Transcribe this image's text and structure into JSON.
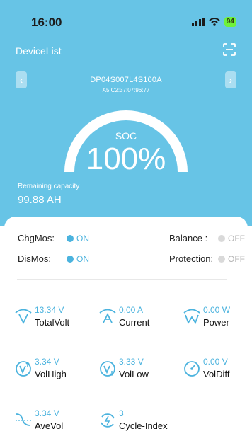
{
  "status": {
    "time": "16:00",
    "battery": "94"
  },
  "nav": {
    "title": "DeviceList"
  },
  "device": {
    "name": "DP04S007L4S100A",
    "mac": "A5:C2:37:07:96:77"
  },
  "soc": {
    "label": "SOC",
    "value": "100%"
  },
  "remaining": {
    "label": "Remaining capacity",
    "value": "99.88 AH"
  },
  "switches": {
    "chgmos": {
      "label": "ChgMos:",
      "state": "ON"
    },
    "dismos": {
      "label": "DisMos:",
      "state": "ON"
    },
    "balance": {
      "label": "Balance :",
      "state": "OFF"
    },
    "protection": {
      "label": "Protection:",
      "state": "OFF"
    }
  },
  "metrics": [
    {
      "value": "13.34 V",
      "name": "TotalVolt",
      "icon": "total-volt-icon"
    },
    {
      "value": "0.00 A",
      "name": "Current",
      "icon": "current-icon"
    },
    {
      "value": "0.00 W",
      "name": "Power",
      "icon": "power-icon"
    },
    {
      "value": "3.34 V",
      "name": "VolHigh",
      "icon": "vol-high-icon"
    },
    {
      "value": "3.33 V",
      "name": "VolLow",
      "icon": "vol-low-icon"
    },
    {
      "value": "0.00 V",
      "name": "VolDiff",
      "icon": "vol-diff-icon"
    },
    {
      "value": "3.34 V",
      "name": "AveVol",
      "icon": "ave-vol-icon"
    },
    {
      "value": "3",
      "name": "Cycle-Index",
      "icon": "cycle-index-icon"
    }
  ],
  "colors": {
    "hero": "#67c4e6",
    "accent": "#4bb3de",
    "on": "#4bb3de",
    "off": "#d9d9d9"
  }
}
